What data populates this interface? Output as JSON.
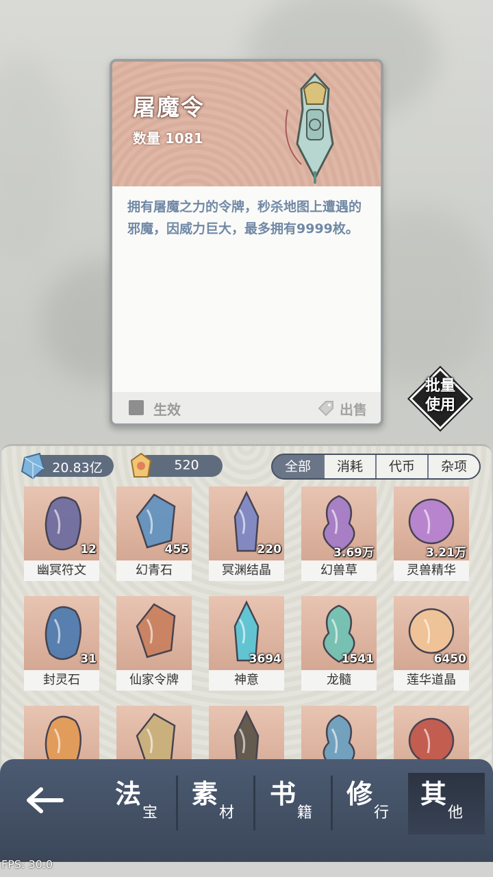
{
  "detail": {
    "name": "屠魔令",
    "quantity": "数量 1081",
    "description": "拥有屠魔之力的令牌，秒杀地图上遭遇的邪魔，因威力巨大，最多拥有9999枚。",
    "effect_label": "生效",
    "sell_label": "出售"
  },
  "batch_use": {
    "line1": "批量",
    "line2": "使用"
  },
  "currency": {
    "crystal": "20.83亿",
    "jade": "520"
  },
  "filters": [
    {
      "label": "全部",
      "active": true
    },
    {
      "label": "消耗",
      "active": false
    },
    {
      "label": "代币",
      "active": false
    },
    {
      "label": "杂项",
      "active": false
    }
  ],
  "items": [
    {
      "name": "幽冥符文",
      "count": "12",
      "color": "#6c6ba0"
    },
    {
      "name": "幻青石",
      "count": "455",
      "color": "#5f92c0"
    },
    {
      "name": "冥渊结晶",
      "count": "220",
      "color": "#7c86c4"
    },
    {
      "name": "幻兽草",
      "count": "3.69万",
      "color": "#a47bc8"
    },
    {
      "name": "灵兽精华",
      "count": "3.21万",
      "color": "#b680d2"
    },
    {
      "name": "封灵石",
      "count": "31",
      "color": "#4d7bb0"
    },
    {
      "name": "仙家令牌",
      "count": "",
      "color": "#c9805e"
    },
    {
      "name": "神意",
      "count": "3694",
      "color": "#58c6d6"
    },
    {
      "name": "龙髓",
      "count": "1541",
      "color": "#6fc2b4"
    },
    {
      "name": "莲华道晶",
      "count": "6450",
      "color": "#f1c497"
    },
    {
      "name": "",
      "count": "",
      "color": "#e29a56"
    },
    {
      "name": "",
      "count": "",
      "color": "#c9b07a"
    },
    {
      "name": "",
      "count": "",
      "color": "#5b5348"
    },
    {
      "name": "",
      "count": "",
      "color": "#6aa0c0"
    },
    {
      "name": "",
      "count": "",
      "color": "#c0564a"
    }
  ],
  "nav": [
    {
      "big": "法",
      "small": "宝",
      "active": false
    },
    {
      "big": "素",
      "small": "材",
      "active": false
    },
    {
      "big": "书",
      "small": "籍",
      "active": false
    },
    {
      "big": "修",
      "small": "行",
      "active": false
    },
    {
      "big": "其",
      "small": "他",
      "active": true
    }
  ],
  "fps": "FPS: 30.0"
}
